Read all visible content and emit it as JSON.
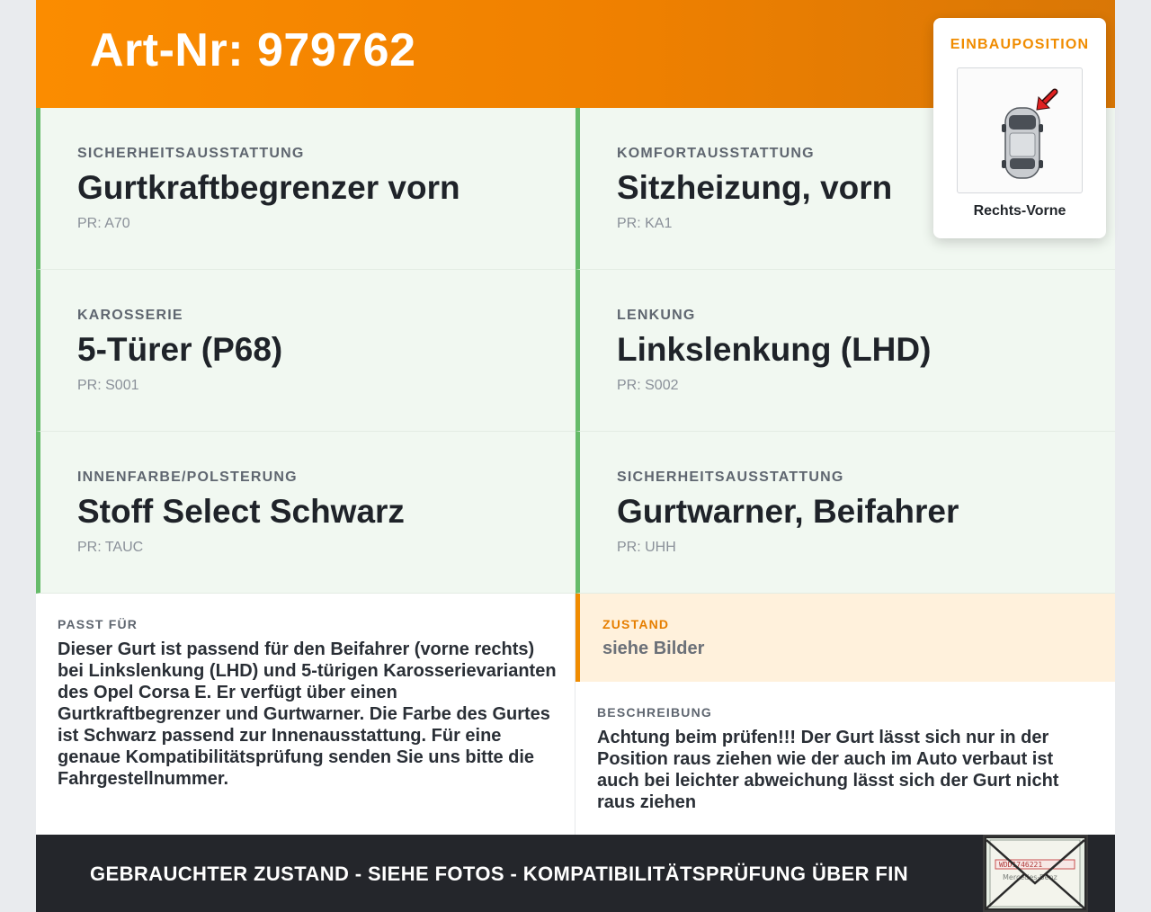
{
  "header": {
    "title": "Art-Nr: 979762"
  },
  "einbauposition": {
    "title": "EINBAUPOSITION",
    "position": "Rechts-Vorne"
  },
  "features": [
    {
      "label": "SICHERHEITSAUSSTATTUNG",
      "value": "Gurtkraftbegrenzer vorn",
      "pr": "PR: A70"
    },
    {
      "label": "KOMFORTAUSSTATTUNG",
      "value": "Sitzheizung, vorn",
      "pr": "PR: KA1"
    },
    {
      "label": "KAROSSERIE",
      "value": "5-Türer (P68)",
      "pr": "PR: S001"
    },
    {
      "label": "LENKUNG",
      "value": "Linkslenkung (LHD)",
      "pr": "PR: S002"
    },
    {
      "label": "INNENFARBE/POLSTERUNG",
      "value": "Stoff Select Schwarz",
      "pr": "PR: TAUC"
    },
    {
      "label": "SICHERHEITSAUSSTATTUNG",
      "value": "Gurtwarner, Beifahrer",
      "pr": "PR: UHH"
    }
  ],
  "passt_fuer": {
    "label": "PASST FÜR",
    "text": "Dieser Gurt ist passend für den Beifahrer (vorne rechts) bei Linkslenkung (LHD) und 5-türigen Karosserievarianten des Opel Corsa E. Er verfügt über einen Gurtkraftbegrenzer und Gurtwarner. Die Farbe des Gurtes ist Schwarz passend zur Innenausstattung. Für eine genaue Kompatibilitätsprüfung senden Sie uns bitte die Fahrgestellnummer."
  },
  "zustand": {
    "label": "ZUSTAND",
    "value": "siehe Bilder"
  },
  "beschreibung": {
    "label": "BESCHREIBUNG",
    "text": "Achtung beim prüfen!!! Der Gurt lässt sich nur in der Position raus ziehen wie der auch im Auto verbaut ist auch bei leichter abweichung lässt sich der Gurt nicht raus ziehen"
  },
  "footer": {
    "text": "GEBRAUCHTER ZUSTAND - SIEHE FOTOS - KOMPATIBILITÄTSPRÜFUNG ÜBER FIN",
    "stamp_text": [
      "WDD1746221",
      "Mercedes-Benz"
    ]
  },
  "colors": {
    "header_orange": "#fb8c00",
    "accent_green": "#66bb6a",
    "accent_orange": "#f08c00",
    "footer_dark": "#24262b"
  }
}
